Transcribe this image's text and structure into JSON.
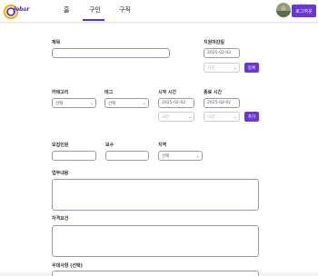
{
  "nav": {
    "logo_text": "jobar",
    "tabs": [
      {
        "label": "홈"
      },
      {
        "label": "구인"
      },
      {
        "label": "구직"
      }
    ],
    "logout_label": "로그아웃"
  },
  "form": {
    "title_label": "제목",
    "deadline_label": "지원마감일",
    "deadline_date": "2025-02-02",
    "deadline_time_placeholder": "시간",
    "register_button": "등록",
    "category_label": "카테고리",
    "category_value": "선택",
    "tag_label": "태그",
    "tag_value": "선택",
    "start_time_label": "시작 시간",
    "start_date": "2025-02-02",
    "start_time_placeholder": "시간",
    "end_time_label": "종료 시간",
    "end_date": "2025-02-02",
    "end_time_placeholder": "시간",
    "add_button": "추가",
    "headcount_label": "모집인원",
    "pay_label": "보수",
    "region_label": "지역",
    "region_value": "선택",
    "duties_label": "업무내용",
    "qualifications_label": "자격요건",
    "preferences_label": "우대사항 (선택)"
  },
  "colors": {
    "accent": "#6a35d9"
  }
}
